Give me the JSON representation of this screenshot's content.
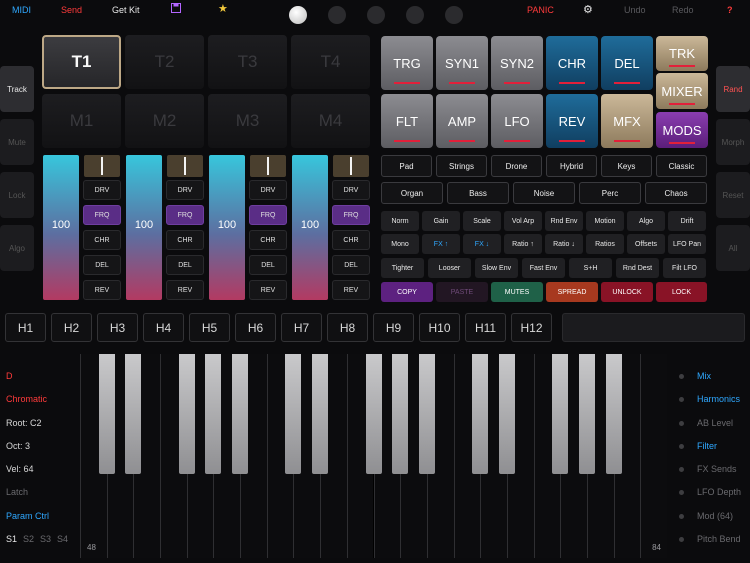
{
  "topbar": {
    "midi": "MIDI",
    "send": "Send",
    "get_kit": "Get Kit",
    "panic": "PANIC",
    "undo": "Undo",
    "redo": "Redo",
    "help": "?",
    "colors": {
      "accent_blue": "#2fa8ff",
      "accent_red": "#ff3b3b",
      "save": "#b366ff",
      "star": "#f2c83c"
    }
  },
  "left_side": [
    "Track",
    "Mute",
    "Lock",
    "Algo"
  ],
  "right_side": [
    "Rand",
    "Morph",
    "Reset",
    "All"
  ],
  "pads": [
    "T1",
    "T2",
    "T3",
    "T4",
    "M1",
    "M2",
    "M3",
    "M4"
  ],
  "tracks": [
    {
      "level": "100",
      "fx": [
        "DRV",
        "FRQ",
        "CHR",
        "DEL",
        "REV"
      ]
    },
    {
      "level": "100",
      "fx": [
        "DRV",
        "FRQ",
        "CHR",
        "DEL",
        "REV"
      ]
    },
    {
      "level": "100",
      "fx": [
        "DRV",
        "FRQ",
        "CHR",
        "DEL",
        "REV"
      ]
    },
    {
      "level": "100",
      "fx": [
        "DRV",
        "FRQ",
        "CHR",
        "DEL",
        "REV"
      ]
    }
  ],
  "modules_row1": [
    "TRG",
    "SYN1",
    "SYN2",
    "CHR",
    "DEL",
    "TRK"
  ],
  "modules_row2": [
    "FLT",
    "AMP",
    "LFO",
    "REV",
    "MFX",
    "MIXER",
    "MODS"
  ],
  "presets_row1": [
    "Pad",
    "Strings",
    "Drone",
    "Hybrid",
    "Keys",
    "Classic"
  ],
  "presets_row2": [
    "Organ",
    "Bass",
    "Noise",
    "Perc",
    "Chaos"
  ],
  "mutate_rows": [
    [
      "Norm",
      "Gain",
      "Scale",
      "Vol Arp",
      "Rnd Env",
      "Motion",
      "Algo",
      "Drift"
    ],
    [
      "Mono",
      "FX ↑",
      "FX ↓",
      "Ratio ↑",
      "Ratio ↓",
      "Ratios",
      "Offsets",
      "LFO Pan"
    ],
    [
      "Tighter",
      "Looser",
      "Slow Env",
      "Fast Env",
      "S+H",
      "Rnd Dest",
      "Filt LFO"
    ]
  ],
  "actions": [
    {
      "label": "COPY",
      "color": "#5d2180",
      "text": "#ffffff"
    },
    {
      "label": "PASTE",
      "color": "#221623",
      "text": "#6e4a78"
    },
    {
      "label": "MUTES",
      "color": "#1f6148",
      "text": "#ffffff"
    },
    {
      "label": "SPREAD",
      "color": "#a7391f",
      "text": "#ffffff"
    },
    {
      "label": "UNLOCK",
      "color": "#891326",
      "text": "#ffffff"
    },
    {
      "label": "LOCK",
      "color": "#891326",
      "text": "#ffffff"
    }
  ],
  "harmonics": [
    "H1",
    "H2",
    "H3",
    "H4",
    "H5",
    "H6",
    "H7",
    "H8",
    "H9",
    "H10",
    "H11",
    "H12"
  ],
  "left_labels": [
    {
      "text": "D",
      "color": "#ff3b3b"
    },
    {
      "text": "Chromatic",
      "color": "#ff3b3b"
    },
    {
      "text": "Root: C2",
      "color": "#d8d8d8"
    },
    {
      "text": "Oct: 3",
      "color": "#d8d8d8"
    },
    {
      "text": "Vel: 64",
      "color": "#d8d8d8"
    },
    {
      "text": "Latch",
      "color": "#6a6a6e"
    },
    {
      "text": "Param Ctrl",
      "color": "#2fa8ff"
    }
  ],
  "slots": [
    "S1",
    "S2",
    "S3",
    "S4"
  ],
  "right_labels": [
    {
      "text": "Mix",
      "color": "#2fa8ff"
    },
    {
      "text": "Harmonics",
      "color": "#2fa8ff"
    },
    {
      "text": "AB Level",
      "color": "#6a6a6e"
    },
    {
      "text": "Filter",
      "color": "#2fa8ff"
    },
    {
      "text": "FX Sends",
      "color": "#6a6a6e"
    },
    {
      "text": "LFO Depth",
      "color": "#6a6a6e"
    },
    {
      "text": "Mod (64)",
      "color": "#6a6a6e"
    },
    {
      "text": "Pitch Bend",
      "color": "#6a6a6e"
    }
  ],
  "keyboard": {
    "low": "48",
    "high": "84"
  }
}
